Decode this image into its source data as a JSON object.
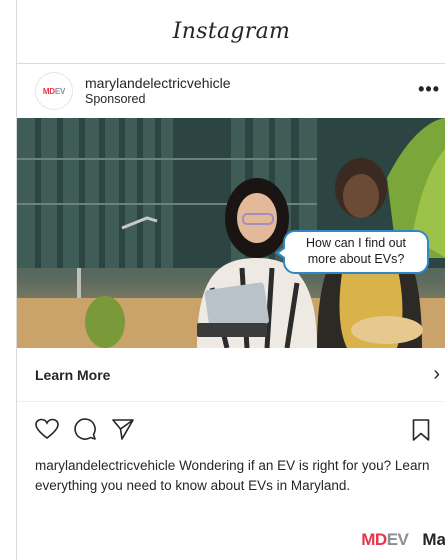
{
  "app": {
    "logo_text": "Instagram"
  },
  "post": {
    "avatar": {
      "md": "MD",
      "ev": "EV"
    },
    "username": "marylandelectricvehicle",
    "sponsored": "Sponsored",
    "more_icon": "more-dots-icon",
    "image": {
      "speech_bubble": "How can I find out more about EVs?"
    },
    "cta": {
      "label": "Learn More",
      "chevron": "›"
    },
    "actions": [
      "heart-icon",
      "comment-icon",
      "share-icon",
      "bookmark-icon"
    ],
    "caption": {
      "user": "marylandelectricvehicle",
      "text": " Wondering if an EV is right for you? Learn everything you need to know about EVs in Maryland."
    },
    "bottom_logo": {
      "md": "MD",
      "ev": "EV",
      "ma": "Ma"
    }
  },
  "colors": {
    "brand_red": "#e8354a",
    "brand_gray": "#8a8f96",
    "bubble_border": "#2e88c8",
    "text": "#262626",
    "divider": "#dbdbdb"
  }
}
